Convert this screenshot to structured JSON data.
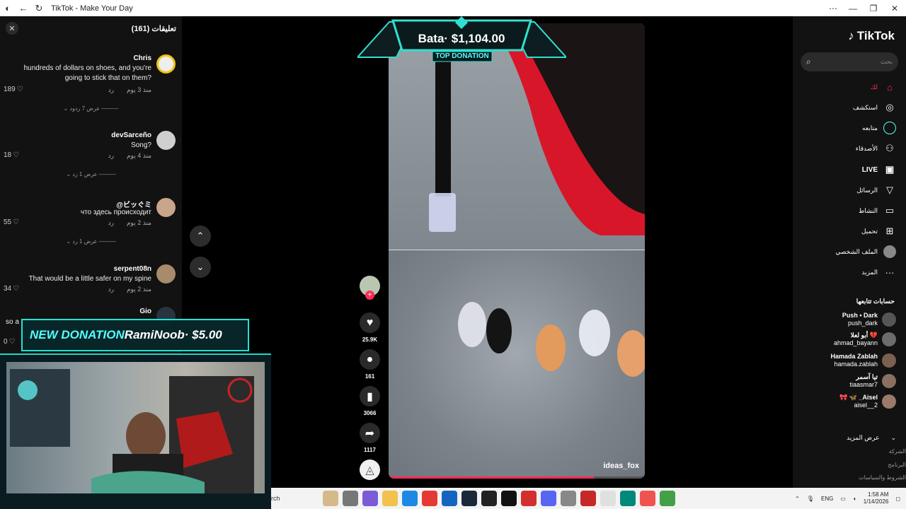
{
  "window": {
    "title": "TikTok - Make Your Day"
  },
  "comments": {
    "header": "تعليقات (161)",
    "items": [
      {
        "user": "Chris",
        "text": "hundreds of dollars on shoes, and you're going to stick that on them?",
        "time": "منذ 3 يوم",
        "reply": "رد",
        "likes": "189",
        "replies": "عرض 7 ردود",
        "avatar_color": "#e9d8a6"
      },
      {
        "user": "devSarceño",
        "text": "Song?",
        "time": "منذ 4 يوم",
        "reply": "رد",
        "likes": "18",
        "replies": "عرض 1 رد",
        "avatar_color": "#cfcfcf"
      },
      {
        "user": "@ビッぐミ",
        "text": "что здесь происходит",
        "time": "منذ 2 يوم",
        "reply": "رد",
        "likes": "55",
        "replies": "عرض 1 رد",
        "avatar_color": "#c9a58a"
      },
      {
        "user": "serpent08n",
        "text": "That would be a little safer on my spine",
        "time": "منذ 2 يوم",
        "reply": "رد",
        "likes": "34",
        "replies": "",
        "avatar_color": "#a88b6d"
      },
      {
        "user": "Gio",
        "text": "so a",
        "time": "",
        "reply": "",
        "likes": "0",
        "replies": "",
        "avatar_color": "#333"
      }
    ]
  },
  "overlay": {
    "top_donation_name": "Bata· $1,104.00",
    "top_donation_label": "TOP DONATION",
    "new_donation_label": "NEW DONATION",
    "new_donation_text": "RamiNoob· $5.00"
  },
  "video": {
    "author": "ideas_fox",
    "progress": 0.8,
    "likes": "25.9K",
    "comments": "161",
    "saves": "3066",
    "shares": "1117"
  },
  "sidebar": {
    "logo": "TikTok",
    "search_placeholder": "بحث",
    "nav": [
      {
        "label": "لك",
        "icon": "home-icon",
        "glyph": "⌂",
        "color": "#fe2c55"
      },
      {
        "label": "استكشف",
        "icon": "compass-icon",
        "glyph": "◎",
        "color": "#fff"
      },
      {
        "label": "متابعه",
        "icon": "following-icon",
        "glyph": "○",
        "color": "#5ff"
      },
      {
        "label": "الأصدقاء",
        "icon": "friends-icon",
        "glyph": "👥",
        "color": "#fff"
      },
      {
        "label": "LIVE",
        "icon": "live-icon",
        "glyph": "▣",
        "color": "#fff"
      },
      {
        "label": "الرسائل",
        "icon": "messages-icon",
        "glyph": "▽",
        "color": "#fff"
      },
      {
        "label": "النشاط",
        "icon": "activity-icon",
        "glyph": "▭",
        "color": "#fff"
      },
      {
        "label": "تحميل",
        "icon": "upload-icon",
        "glyph": "⊞",
        "color": "#fff"
      },
      {
        "label": "الملف الشخصي",
        "icon": "profile-icon",
        "glyph": "●",
        "color": "#fff"
      },
      {
        "label": "المزيد",
        "icon": "more-icon",
        "glyph": "···",
        "color": "#fff"
      }
    ],
    "following_title": "حسابات تتابعها",
    "accounts": [
      {
        "name": "Push • Dark",
        "handle": "push_dark"
      },
      {
        "name": "أبو لعلا 💔",
        "handle": "ahmad_bayann"
      },
      {
        "name": "Hamada Zablah",
        "handle": "hamada.zablah"
      },
      {
        "name": "تيا آسمر",
        "handle": "tiaasmar7"
      },
      {
        "name": "🎀 🦋 _Aisel",
        "handle": "aisel__2"
      }
    ],
    "see_more": "عرض المزيد",
    "footer": [
      "الشركة",
      "البرنامج",
      "الشروط والسياسات"
    ]
  },
  "taskbar": {
    "search": "rch",
    "lang": "ENG",
    "time": "1:58 AM",
    "date": "1/14/2026"
  }
}
